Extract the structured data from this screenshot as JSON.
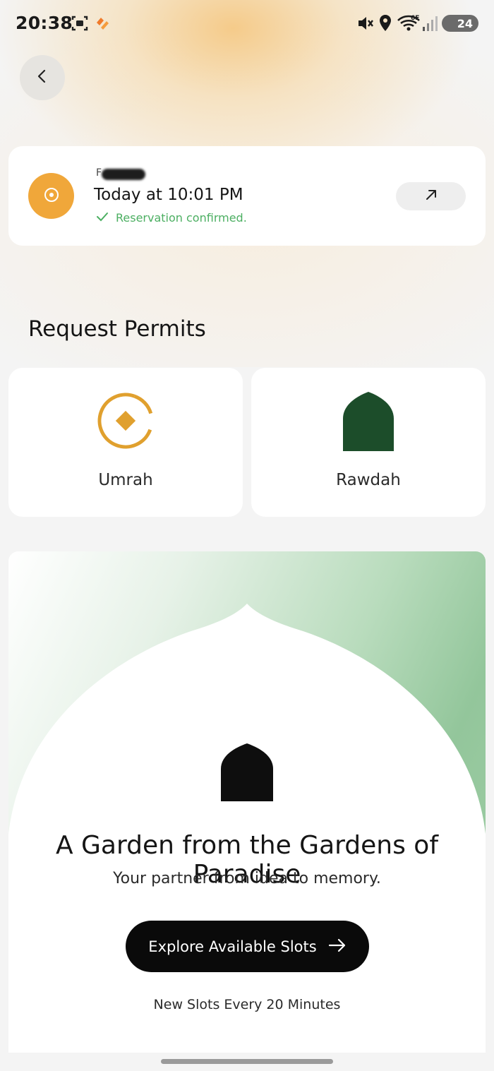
{
  "status_bar": {
    "time": "20:38",
    "battery": "24",
    "network": "6E",
    "icons": [
      "screenshot-icon",
      "app-logo-icon",
      "mute-icon",
      "location-icon",
      "wifi-icon",
      "signal-icon",
      "battery-icon"
    ]
  },
  "booking": {
    "name_partial": "F",
    "time": "Today at 10:01 PM",
    "status": "Reservation confirmed.",
    "status_color": "#4caf62",
    "logo_color": "#f0a73a"
  },
  "permits": {
    "title": "Request Permits",
    "items": [
      {
        "label": "Umrah",
        "icon": "umrah-icon",
        "color": "#e0a02e"
      },
      {
        "label": "Rawdah",
        "icon": "rawdah-dome-icon",
        "color": "#1c4d2a"
      }
    ]
  },
  "promo": {
    "title": "A Garden from the Gardens of Paradise",
    "subtitle": "Your partner from idea to memory.",
    "cta_label": "Explore Available Slots",
    "note": "New Slots Every 20 Minutes"
  },
  "colors": {
    "accent_orange": "#f0a73a",
    "accent_green": "#1c4d2a",
    "confirm_green": "#4caf62"
  }
}
